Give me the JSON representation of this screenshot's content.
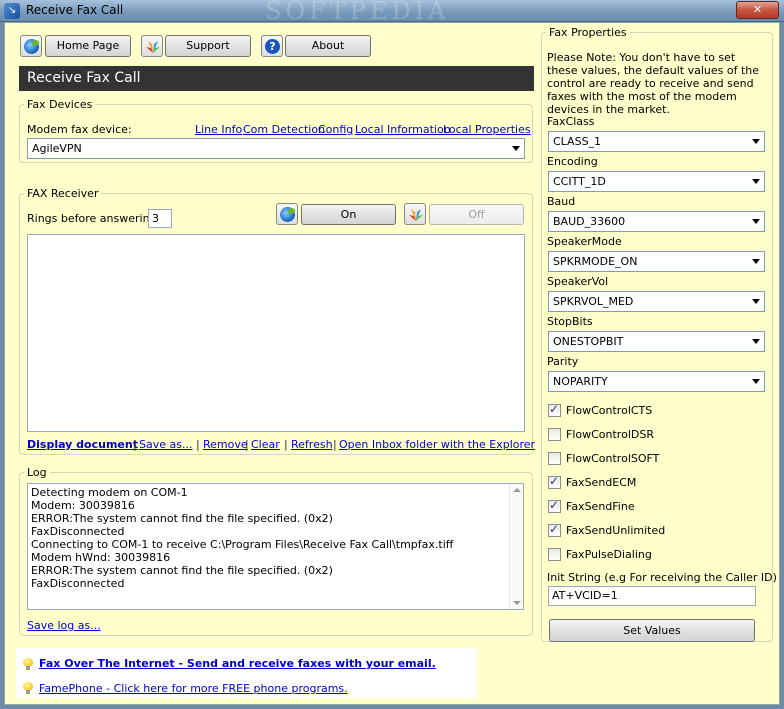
{
  "window": {
    "title": "Receive Fax Call",
    "watermark": "SOFTPEDIA",
    "close_glyph": "✕"
  },
  "toolbar": {
    "home_label": "Home Page",
    "support_label": "Support",
    "about_label": "About",
    "help_glyph": "?"
  },
  "header": {
    "title": "Receive Fax Call"
  },
  "fax_devices": {
    "legend": "Fax Devices",
    "modem_label": "Modem fax device:",
    "links": [
      "Line Info",
      "Com Detection",
      "Config",
      "Local Information",
      "Local Properties"
    ],
    "modem_value": "AgileVPN"
  },
  "fax_receiver": {
    "legend": "FAX Receiver",
    "rings_label": "Rings before answering:",
    "rings_value": "3",
    "on_label": "On",
    "off_label": "Off",
    "links": [
      "Display document",
      "Save as...",
      "Remove",
      "Clear",
      "Refresh",
      "Open Inbox folder with the Explorer"
    ],
    "separator": "|"
  },
  "log": {
    "legend": "Log",
    "lines": [
      "Detecting modem on COM-1",
      "Modem: 30039816",
      "ERROR:The system cannot find the file specified. (0x2)",
      "FaxDisconnected",
      "Connecting to COM-1 to receive C:\\Program Files\\Receive Fax Call\\tmpfax.tiff",
      "Modem hWnd: 30039816",
      "ERROR:The system cannot find the file specified. (0x2)",
      "FaxDisconnected"
    ],
    "save_link": "Save log as..."
  },
  "fax_properties": {
    "legend": "Fax Properties",
    "note": "Please Note: You don't have to set these values, the default values of the control are ready to receive and send faxes with the most of the modem devices in the market.",
    "fields": [
      {
        "label": "FaxClass",
        "value": "CLASS_1"
      },
      {
        "label": "Encoding",
        "value": "CCITT_1D"
      },
      {
        "label": "Baud",
        "value": "BAUD_33600"
      },
      {
        "label": "SpeakerMode",
        "value": "SPKRMODE_ON"
      },
      {
        "label": "SpeakerVol",
        "value": "SPKRVOL_MED"
      },
      {
        "label": "StopBits",
        "value": "ONESTOPBIT"
      },
      {
        "label": "Parity",
        "value": "NOPARITY"
      }
    ],
    "checks": [
      {
        "label": "FlowControlCTS",
        "checked": true
      },
      {
        "label": "FlowControlDSR",
        "checked": false
      },
      {
        "label": "FlowControlSOFT",
        "checked": false
      },
      {
        "label": "FaxSendECM",
        "checked": true
      },
      {
        "label": "FaxSendFine",
        "checked": true
      },
      {
        "label": "FaxSendUnlimited",
        "checked": true
      },
      {
        "label": "FaxPulseDialing",
        "checked": false
      }
    ],
    "check_glyph": "✓",
    "init_label": "Init String (e.g For receiving the Caller ID)",
    "init_value": "AT+VCID=1",
    "set_button": "Set Values"
  },
  "footer": {
    "link1": "Fax Over The Internet - Send and receive faxes with your email.",
    "link2": "FamePhone - Click here for more FREE phone programs."
  }
}
